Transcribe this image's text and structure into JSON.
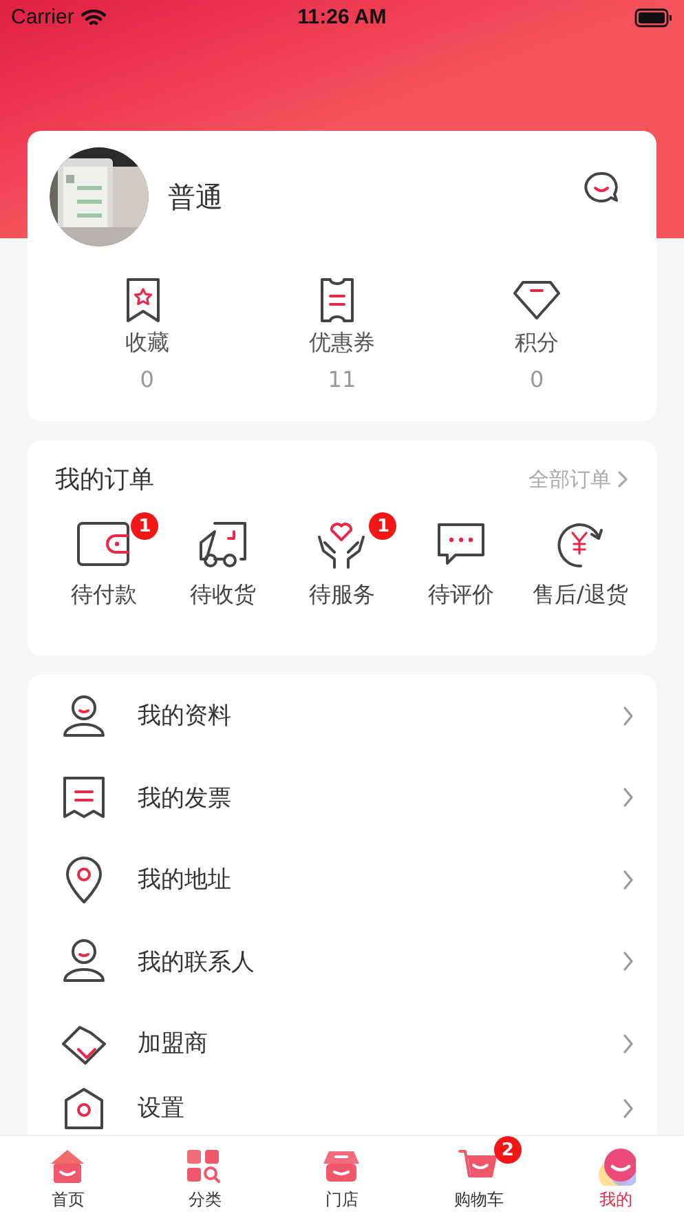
{
  "status_bar": {
    "carrier": "Carrier",
    "time": "11:26 AM"
  },
  "profile": {
    "name": "普通",
    "stats": [
      {
        "kind": "favorites",
        "label": "收藏",
        "value": "0"
      },
      {
        "kind": "coupons",
        "label": "优惠券",
        "value": "11"
      },
      {
        "kind": "points",
        "label": "积分",
        "value": "0"
      }
    ]
  },
  "orders": {
    "title": "我的订单",
    "all_link": "全部订单",
    "items": [
      {
        "kind": "payment",
        "label": "待付款",
        "badge": "1"
      },
      {
        "kind": "shipping",
        "label": "待收货"
      },
      {
        "kind": "service",
        "label": "待服务",
        "badge": "1"
      },
      {
        "kind": "review",
        "label": "待评价"
      },
      {
        "kind": "refund",
        "label": "售后/退货"
      }
    ]
  },
  "menu": [
    {
      "kind": "profile",
      "label": "我的资料"
    },
    {
      "kind": "invoice",
      "label": "我的发票"
    },
    {
      "kind": "address",
      "label": "我的地址"
    },
    {
      "kind": "contacts",
      "label": "我的联系人"
    },
    {
      "kind": "franchise",
      "label": "加盟商"
    },
    {
      "kind": "settings",
      "label": "设置"
    }
  ],
  "tab_bar": [
    {
      "kind": "home",
      "label": "首页",
      "selected": false
    },
    {
      "kind": "category",
      "label": "分类",
      "selected": false
    },
    {
      "kind": "store",
      "label": "门店",
      "selected": false
    },
    {
      "kind": "cart",
      "label": "购物车",
      "selected": false,
      "badge": "2"
    },
    {
      "kind": "me",
      "label": "我的",
      "selected": true
    }
  ]
}
